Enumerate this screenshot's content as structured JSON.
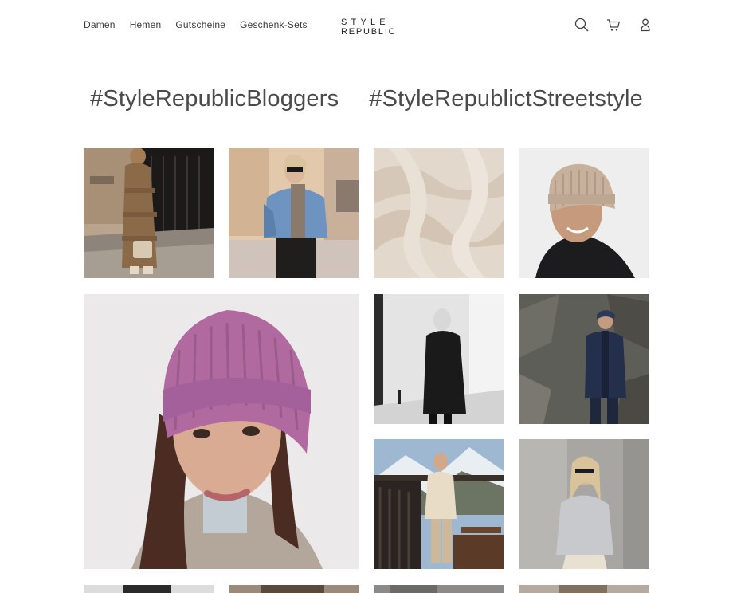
{
  "header": {
    "nav": [
      "Damen",
      "Hemen",
      "Gutscheine",
      "Geschenk-Sets"
    ],
    "logo_line1": "STYLE",
    "logo_line2": "REPUBLIC",
    "icons": [
      "search-icon",
      "cart-icon",
      "account-icon"
    ]
  },
  "hashtags": [
    "#StyleRepublicBloggers",
    "#StyleRepublictStreetstyle"
  ],
  "gallery": {
    "tiles": [
      {
        "name": "photo-woman-puffer-coat-street"
      },
      {
        "name": "photo-woman-blue-sweater-scarf"
      },
      {
        "name": "photo-cream-cashmere-fabric"
      },
      {
        "name": "photo-man-beige-beanie"
      },
      {
        "name": "photo-woman-pink-beanie"
      },
      {
        "name": "photo-mannequin-black-coat"
      },
      {
        "name": "photo-man-navy-coat-rocks"
      },
      {
        "name": "photo-woman-balcony-snow"
      },
      {
        "name": "photo-woman-grey-sweater"
      }
    ]
  },
  "colors": {
    "text": "#3a3a3a",
    "background": "#ffffff"
  }
}
